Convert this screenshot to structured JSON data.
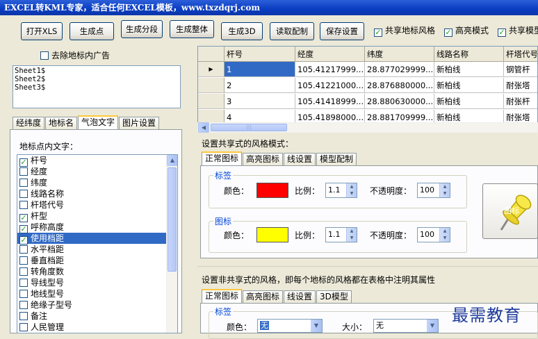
{
  "window": {
    "title": "EXCEL转KML专家，适合任何EXCEL模板，www.txzdqrj.com"
  },
  "toolbar": {
    "buttons": [
      "打开XLS",
      "生成点",
      "生成分段",
      "生成整体",
      "生成3D",
      "读取配制",
      "保存设置"
    ],
    "checks": [
      {
        "label": "共享地标风格",
        "checked": true
      },
      {
        "label": "高亮模式",
        "checked": true
      },
      {
        "label": "共享模型",
        "checked": true
      }
    ]
  },
  "left": {
    "remove_ads": {
      "label": "去除地标内广告",
      "checked": false
    },
    "sheets": [
      "Sheet1$",
      "Sheet2$",
      "Sheet3$"
    ],
    "tabs": [
      "经纬度",
      "地标名",
      "气泡文字",
      "图片设置"
    ],
    "active_tab": 2,
    "caption": "地标点内文字：",
    "fields": [
      {
        "label": "杆号",
        "checked": true,
        "selected": false
      },
      {
        "label": "经度",
        "checked": false,
        "selected": false
      },
      {
        "label": "纬度",
        "checked": false,
        "selected": false
      },
      {
        "label": "线路名称",
        "checked": false,
        "selected": false
      },
      {
        "label": "杆塔代号",
        "checked": false,
        "selected": false
      },
      {
        "label": "杆型",
        "checked": true,
        "selected": false
      },
      {
        "label": "呼称高度",
        "checked": true,
        "selected": false
      },
      {
        "label": "使用档距",
        "checked": true,
        "selected": true
      },
      {
        "label": "水平档距",
        "checked": false,
        "selected": false
      },
      {
        "label": "垂直档距",
        "checked": false,
        "selected": false
      },
      {
        "label": "转角度数",
        "checked": false,
        "selected": false
      },
      {
        "label": "导线型号",
        "checked": false,
        "selected": false
      },
      {
        "label": "地线型号",
        "checked": false,
        "selected": false
      },
      {
        "label": "绝缘子型号",
        "checked": false,
        "selected": false
      },
      {
        "label": "备注",
        "checked": false,
        "selected": false
      },
      {
        "label": "人民管理",
        "checked": false,
        "selected": false
      }
    ]
  },
  "grid": {
    "columns": [
      "杆号",
      "经度",
      "纬度",
      "线路名称",
      "杆塔代号"
    ],
    "rows": [
      [
        "1",
        "105.41217999...",
        "28.877029999...",
        "新柏线",
        "钢管杆"
      ],
      [
        "2",
        "105.41221000...",
        "28.876880000...",
        "新柏线",
        "耐张塔"
      ],
      [
        "3",
        "105.41418999...",
        "28.880630000...",
        "新柏线",
        "耐张杆"
      ],
      [
        "4",
        "105.41898000...",
        "28.881709999...",
        "新柏线",
        "耐张塔"
      ]
    ]
  },
  "shared_style": {
    "title": "设置共享式的风格模式：",
    "tabs": [
      "正常图标",
      "高亮图标",
      "线设置",
      "模型配制"
    ],
    "label_group": {
      "title": "标签",
      "color_label": "颜色：",
      "color": "#ff0000",
      "scale_label": "比例：",
      "scale": "1.1",
      "opacity_label": "不透明度：",
      "opacity": "100"
    },
    "icon_group": {
      "title": "图标",
      "color_label": "颜色：",
      "color": "#ffff00",
      "scale_label": "比例：",
      "scale": "1.1",
      "opacity_label": "不透明度：",
      "opacity": "100"
    },
    "icon_button_label": "图标"
  },
  "nonshared_style": {
    "title": "设置非共享式的风格，即每个地标的风格都在表格中注明其属性",
    "tabs": [
      "正常图标",
      "高亮图标",
      "线设置",
      "3D模型"
    ],
    "label_group": {
      "title": "标签",
      "color_label": "颜色：",
      "color_value": "无",
      "size_label": "大小：",
      "size_value": "无"
    }
  },
  "watermark": "最需教育"
}
